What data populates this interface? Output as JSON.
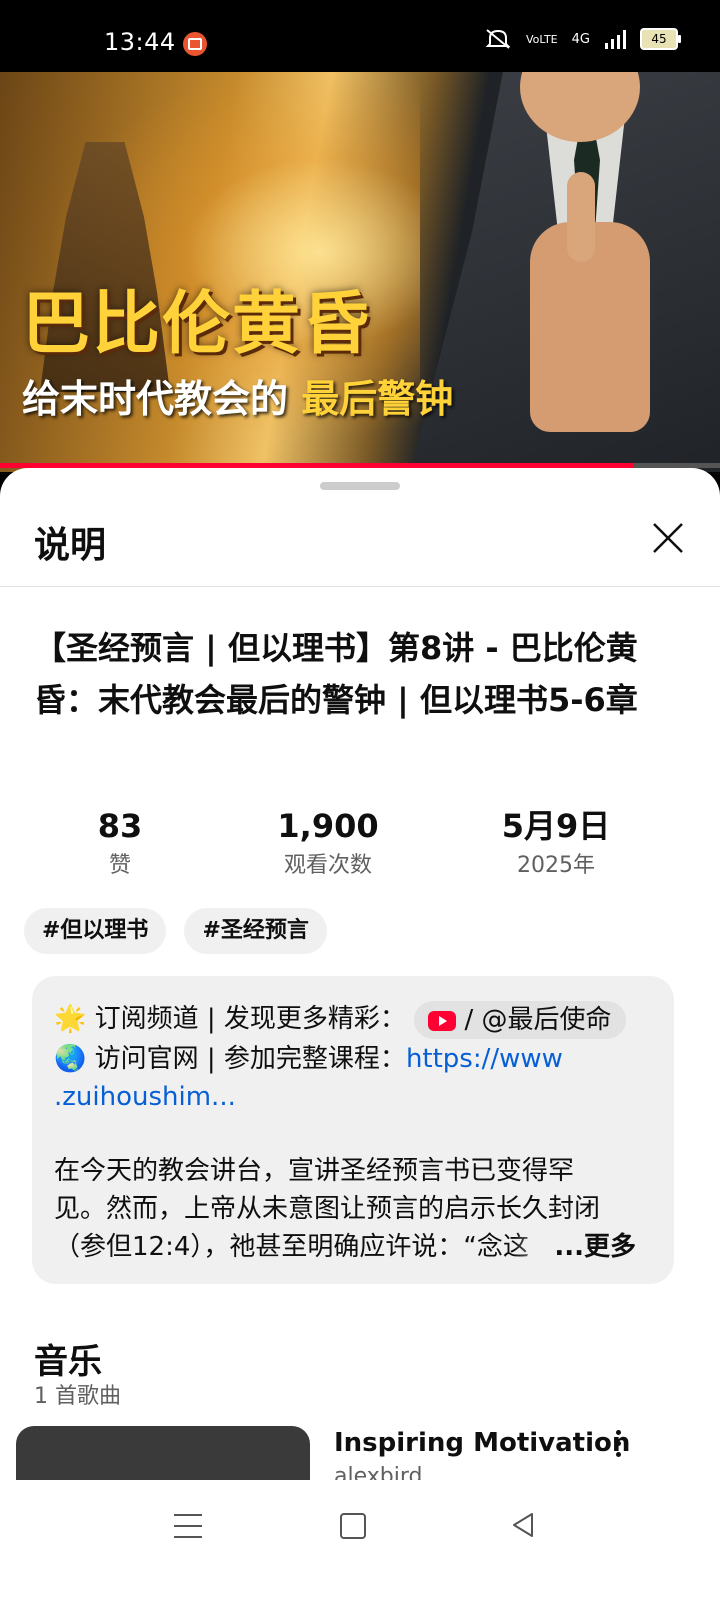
{
  "status_bar": {
    "time": "13:44",
    "signal_label": "4G",
    "volte_label": "VoLTE",
    "battery": "45"
  },
  "video": {
    "overlay_title": "巴比伦黄昏",
    "overlay_sub_white": "给末时代教会的",
    "overlay_sub_highlight": "最后警钟",
    "progress": 0.88,
    "progress_color": "#ff0033"
  },
  "sheet": {
    "title": "说明",
    "video_title": "【圣经预言 | 但以理书】第8讲 - 巴比伦黄昏：末代教会最后的警钟 | 但以理书5-6章",
    "stats": [
      {
        "value": "83",
        "label": "赞"
      },
      {
        "value": "1,900",
        "label": "观看次数"
      },
      {
        "value": "5月9日",
        "label": "2025年"
      }
    ],
    "tags": [
      "#但以理书",
      "#圣经预言"
    ],
    "description": {
      "line1_emoji": "🌟",
      "line1_text": " 订阅频道 | 发现更多精彩：",
      "channel_chip": " / @最后使命",
      "line2_emoji": "🌏",
      "line2_text": " 访问官网 | 参加完整课程：",
      "link_part1": "https://www",
      "link_part2": ".zuihoushim...",
      "body_line1": "在今天的教会讲台，宣讲圣经预言书已变得罕",
      "body_line2": "见。然而，上帝从未意图让预言的启示长久封闭",
      "body_line3": "（参但12:4），祂甚至明确应许说：“念这",
      "more_label": "...更多"
    },
    "music": {
      "title": "音乐",
      "count": "1 首歌曲",
      "song_title": "Inspiring Motivation",
      "song_artist": "alexbird"
    }
  }
}
